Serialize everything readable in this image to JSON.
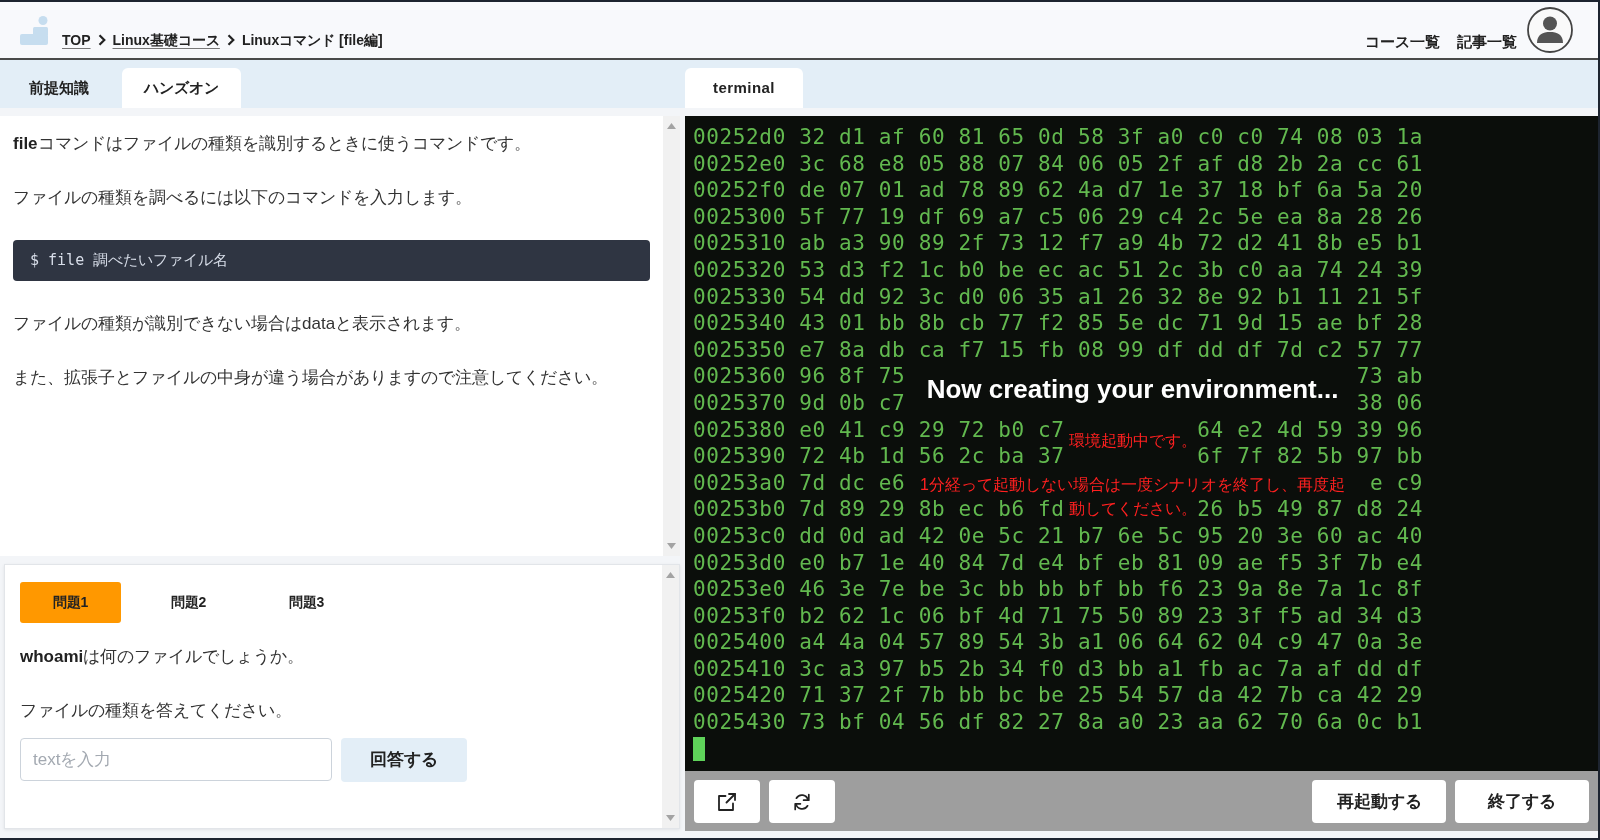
{
  "header": {
    "breadcrumb": [
      {
        "label": "TOP",
        "link": true
      },
      {
        "label": "Linux基礎コース",
        "link": true
      },
      {
        "label": "Linuxコマンド [file編]",
        "link": false
      }
    ],
    "nav_links": [
      "コース一覧",
      "記事一覧"
    ]
  },
  "left_tabs": [
    {
      "label": "前提知識",
      "selected": false
    },
    {
      "label": "ハンズオン",
      "selected": true
    }
  ],
  "right_tabs": [
    {
      "label": "terminal",
      "selected": true
    }
  ],
  "article": [
    {
      "kind": "paragraph",
      "text": "**file**コマンドはファイルの種類を識別するときに使うコマンドです。"
    },
    {
      "kind": "paragraph",
      "text": "ファイルの種類を調べるには以下のコマンドを入力します。"
    },
    {
      "kind": "code",
      "text": "$ file 調べたいファイル名"
    },
    {
      "kind": "paragraph",
      "text": "ファイルの種類が識別できない場合はdataと表示されます。"
    },
    {
      "kind": "paragraph",
      "text": "また、拡張子とファイルの中身が違う場合がありますので注意してください。"
    }
  ],
  "quiz": {
    "tabs": [
      {
        "label": "問題1",
        "selected": true
      },
      {
        "label": "問題2",
        "selected": false
      },
      {
        "label": "問題3",
        "selected": false
      }
    ],
    "question": "**whoami**は何のファイルでしょうか。",
    "instruction": "ファイルの種類を答えてください。",
    "answer_field": {
      "placeholder": "textを入力"
    },
    "submit_button": "回答する"
  },
  "terminal": {
    "lines": [
      {
        "kind": "full",
        "text": "00252d0 32 d1 af 60 81 65 0d 58 3f a0 c0 c0 74 08 03 1a"
      },
      {
        "kind": "full",
        "text": "00252e0 3c 68 e8 05 88 07 84 06 05 2f af d8 2b 2a cc 61"
      },
      {
        "kind": "full",
        "text": "00252f0 de 07 01 ad 78 89 62 4a d7 1e 37 18 bf 6a 5a 20"
      },
      {
        "kind": "full",
        "text": "0025300 5f 77 19 df 69 a7 c5 06 29 c4 2c 5e ea 8a 28 26"
      },
      {
        "kind": "full",
        "text": "0025310 ab a3 90 89 2f 73 12 f7 a9 4b 72 d2 41 8b e5 b1"
      },
      {
        "kind": "full",
        "text": "0025320 53 d3 f2 1c b0 be ec ac 51 2c 3b c0 aa 74 24 39"
      },
      {
        "kind": "full",
        "text": "0025330 54 dd 92 3c d0 06 35 a1 26 32 8e 92 b1 11 21 5f"
      },
      {
        "kind": "full",
        "text": "0025340 43 01 bb 8b cb 77 f2 85 5e dc 71 9d 15 ae bf 28"
      },
      {
        "kind": "full",
        "text": "0025350 e7 8a db ca f7 15 fb 08 99 df dd df 7d c2 57 77"
      },
      {
        "kind": "split",
        "left": "0025360 96 8f 75",
        "right": "73 ab"
      },
      {
        "kind": "split",
        "left": "0025370 9d 0b c7",
        "right": "38 06"
      },
      {
        "kind": "split",
        "left": "0025380 e0 41 c9 29 72 b0 c7",
        "right": "64 e2 4d 59 39 96"
      },
      {
        "kind": "split",
        "left": "0025390 72 4b 1d 56 2c ba 37",
        "right": "6f 7f 82 5b 97 bb"
      },
      {
        "kind": "split",
        "left": "00253a0 7d dc e6",
        "right": "e c9"
      },
      {
        "kind": "split",
        "left": "00253b0 7d 89 29 8b ec b6 fd",
        "right": "26 b5 49 87 d8 24"
      },
      {
        "kind": "full",
        "text": "00253c0 dd 0d ad 42 0e 5c 21 b7 6e 5c 95 20 3e 60 ac 40"
      },
      {
        "kind": "full",
        "text": "00253d0 e0 b7 1e 40 84 7d e4 bf eb 81 09 ae f5 3f 7b e4"
      },
      {
        "kind": "full",
        "text": "00253e0 46 3e 7e be 3c bb bb bf bb f6 23 9a 8e 7a 1c 8f"
      },
      {
        "kind": "full",
        "text": "00253f0 b2 62 1c 06 bf 4d 71 75 50 89 23 3f f5 ad 34 d3"
      },
      {
        "kind": "full",
        "text": "0025400 a4 4a 04 57 89 54 3b a1 06 64 62 04 c9 47 0a 3e"
      },
      {
        "kind": "full",
        "text": "0025410 3c a3 97 b5 2b 34 f0 d3 bb a1 fb ac 7a af dd df"
      },
      {
        "kind": "full",
        "text": "0025420 71 37 2f 7b bb bc be 25 54 57 da 42 7b ca 42 29"
      },
      {
        "kind": "full",
        "text": "0025430 73 bf 04 56 df 82 27 8a a0 23 aa 62 70 6a 0c b1"
      }
    ],
    "overlay": {
      "title": "Now creating your environment...",
      "status": "環境起動中です。",
      "note_lines": [
        "1分経って起動しない場合は一度シナリオを終了し、再度起",
        "動してください。"
      ]
    },
    "toolbar_buttons": [
      "再起動する",
      "終了する"
    ]
  }
}
